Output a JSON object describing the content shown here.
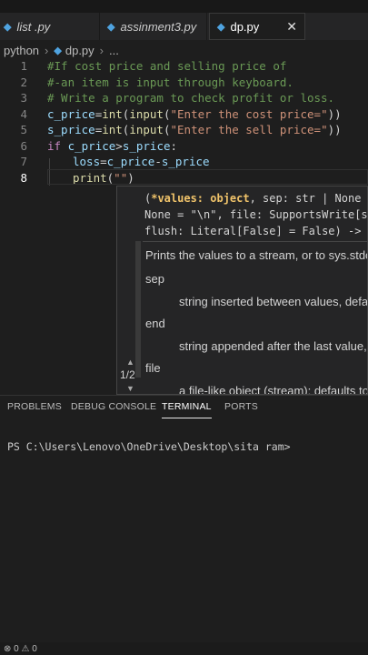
{
  "tabs": [
    {
      "label": "list .py",
      "icon": "python-file-icon"
    },
    {
      "label": "assinment3.py",
      "icon": "python-file-icon"
    },
    {
      "label": "dp.py",
      "icon": "python-file-icon",
      "active": true,
      "close": "✕"
    }
  ],
  "file_icon_glyph": "◆",
  "breadcrumb": {
    "folder": "python",
    "sep": "›",
    "file": "dp.py",
    "tail": "..."
  },
  "editor": {
    "line_numbers": [
      "1",
      "2",
      "3",
      "4",
      "5",
      "6",
      "7",
      "8"
    ],
    "lines": {
      "l1": "#If cost price and selling price of",
      "l2": "#-an item is input through keyboard.",
      "l3": "# Write a program to check profit or loss.",
      "l4": {
        "a": "c_price",
        "b": "=",
        "c": "int",
        "d": "(",
        "e": "input",
        "f": "(",
        "g": "\"Enter the cost price=\"",
        "h": "))"
      },
      "l5": {
        "a": "s_price",
        "b": "=",
        "c": "int",
        "d": "(",
        "e": "input",
        "f": "(",
        "g": "\"Enter the sell price=\"",
        "h": "))"
      },
      "l6": {
        "a": "if",
        "b": " c_price",
        "c": ">",
        "d": "s_price",
        "e": ":"
      },
      "l7": {
        "a": "loss",
        "b": "=",
        "c": "c_price",
        "d": "-",
        "e": "s_price"
      },
      "l8": {
        "a": "print",
        "b": "(",
        "c": "\"\"",
        "d": ")"
      }
    }
  },
  "popup": {
    "sig1_open": "(",
    "sig1_hl": "*values: object",
    "sig1_rest": ", sep: str | None = ",
    "sig2": "None = \"\\n\", file: SupportsWrite[st",
    "sig3": "flush: Literal[False] = False) -> N",
    "desc": "Prints the values to a stream, or to sys.stdou",
    "p1_name": "sep",
    "p1_desc": "string inserted between values, defau",
    "p2_name": "end",
    "p2_desc": "string appended after the last value, ",
    "p3_name": "file",
    "p3_desc": "a file-like object (stream); defaults to",
    "counter": "1/2",
    "up": "▲",
    "down": "▼"
  },
  "panel_tabs": [
    "PROBLEMS",
    "DEBUG CONSOLE",
    "TERMINAL",
    "PORTS"
  ],
  "terminal": {
    "prompt": "PS C:\\Users\\Lenovo\\OneDrive\\Desktop\\sita ram>"
  },
  "status": {
    "errors": "⊗ 0 ⚠ 0"
  }
}
